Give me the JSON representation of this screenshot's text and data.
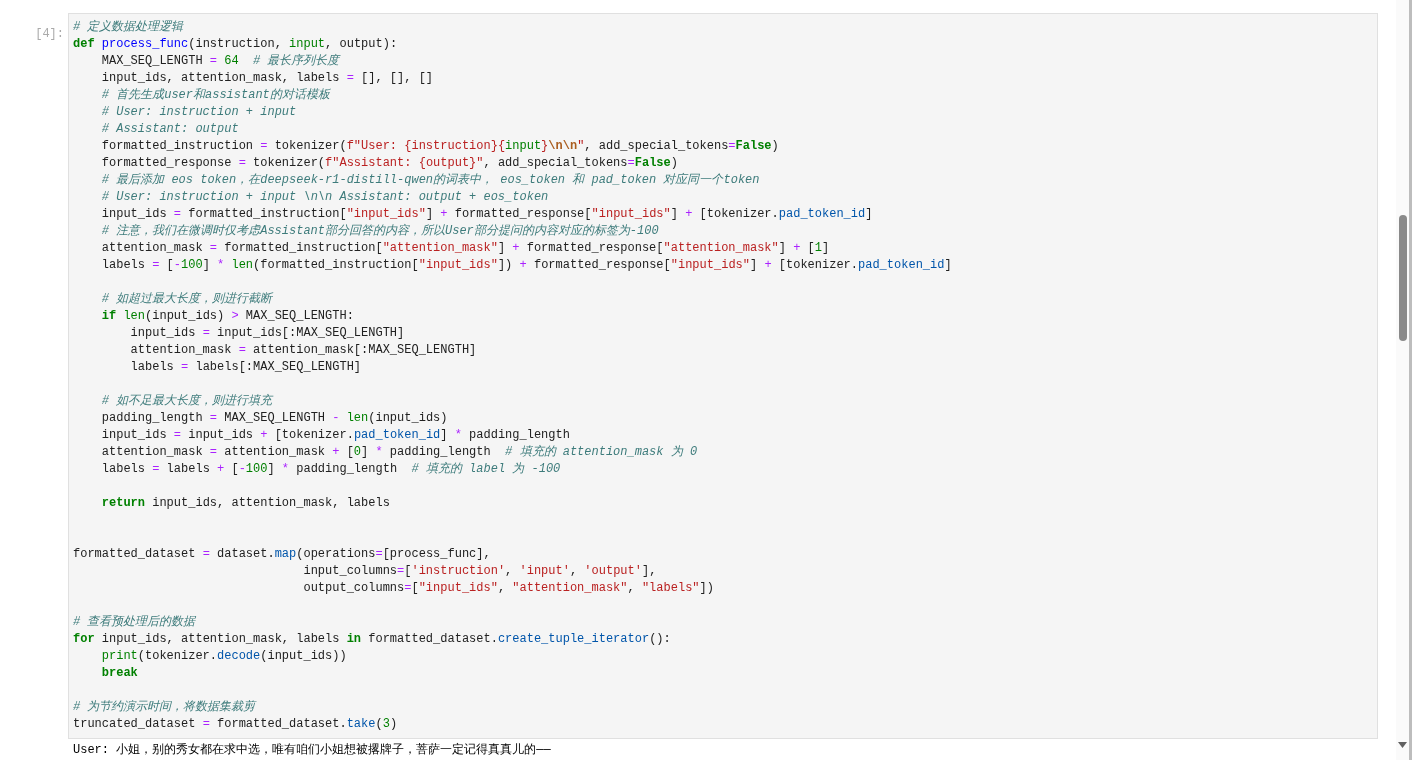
{
  "cell": {
    "prompt": "[4]:",
    "lines": [
      {
        "tokens": [
          {
            "kind": "comment",
            "text": "# 定义数据处理逻辑"
          }
        ]
      },
      {
        "tokens": [
          {
            "kind": "keyword",
            "text": "def "
          },
          {
            "kind": "function",
            "text": "process_func"
          },
          {
            "kind": "plain",
            "text": "(instruction, "
          },
          {
            "kind": "builtin",
            "text": "input"
          },
          {
            "kind": "plain",
            "text": ", output):"
          }
        ]
      },
      {
        "tokens": [
          {
            "kind": "plain",
            "text": "    MAX_SEQ_LENGTH "
          },
          {
            "kind": "operator",
            "text": "= "
          },
          {
            "kind": "number",
            "text": "64"
          },
          {
            "kind": "comment",
            "text": "  # 最长序列长度"
          }
        ]
      },
      {
        "tokens": [
          {
            "kind": "plain",
            "text": "    input_ids, attention_mask, labels "
          },
          {
            "kind": "operator",
            "text": "="
          },
          {
            "kind": "plain",
            "text": " [], [], []"
          }
        ]
      },
      {
        "tokens": [
          {
            "kind": "comment",
            "text": "    # 首先生成user和assistant的对话模板"
          }
        ]
      },
      {
        "tokens": [
          {
            "kind": "comment",
            "text": "    # User: instruction + input"
          }
        ]
      },
      {
        "tokens": [
          {
            "kind": "comment",
            "text": "    # Assistant: output"
          }
        ]
      },
      {
        "tokens": [
          {
            "kind": "plain",
            "text": "    formatted_instruction "
          },
          {
            "kind": "operator",
            "text": "="
          },
          {
            "kind": "plain",
            "text": " tokenizer("
          },
          {
            "kind": "string",
            "text": "f\"User: {instruction}{"
          },
          {
            "kind": "builtin",
            "text": "input"
          },
          {
            "kind": "string",
            "text": "}"
          },
          {
            "kind": "escape",
            "text": "\\n\\n"
          },
          {
            "kind": "string",
            "text": "\""
          },
          {
            "kind": "plain",
            "text": ", add_special_tokens"
          },
          {
            "kind": "operator",
            "text": "="
          },
          {
            "kind": "keyword",
            "text": "False"
          },
          {
            "kind": "plain",
            "text": ")"
          }
        ]
      },
      {
        "tokens": [
          {
            "kind": "plain",
            "text": "    formatted_response "
          },
          {
            "kind": "operator",
            "text": "="
          },
          {
            "kind": "plain",
            "text": " tokenizer("
          },
          {
            "kind": "string",
            "text": "f\"Assistant: {output}\""
          },
          {
            "kind": "plain",
            "text": ", add_special_tokens"
          },
          {
            "kind": "operator",
            "text": "="
          },
          {
            "kind": "keyword",
            "text": "False"
          },
          {
            "kind": "plain",
            "text": ")"
          }
        ]
      },
      {
        "tokens": [
          {
            "kind": "comment",
            "text": "    # 最后添加 eos token，在deepseek-r1-distill-qwen的词表中， eos_token 和 pad_token 对应同一个token"
          }
        ]
      },
      {
        "tokens": [
          {
            "kind": "comment",
            "text": "    # User: instruction + input \\n\\n Assistant: output + eos_token"
          }
        ]
      },
      {
        "tokens": [
          {
            "kind": "plain",
            "text": "    input_ids "
          },
          {
            "kind": "operator",
            "text": "="
          },
          {
            "kind": "plain",
            "text": " formatted_instruction["
          },
          {
            "kind": "string",
            "text": "\"input_ids\""
          },
          {
            "kind": "plain",
            "text": "] "
          },
          {
            "kind": "operator",
            "text": "+"
          },
          {
            "kind": "plain",
            "text": " formatted_response["
          },
          {
            "kind": "string",
            "text": "\"input_ids\""
          },
          {
            "kind": "plain",
            "text": "] "
          },
          {
            "kind": "operator",
            "text": "+"
          },
          {
            "kind": "plain",
            "text": " [tokenizer."
          },
          {
            "kind": "attribute",
            "text": "pad_token_id"
          },
          {
            "kind": "plain",
            "text": "]"
          }
        ]
      },
      {
        "tokens": [
          {
            "kind": "comment",
            "text": "    # 注意，我们在微调时仅考虑Assistant部分回答的内容，所以User部分提问的内容对应的标签为-100"
          }
        ]
      },
      {
        "tokens": [
          {
            "kind": "plain",
            "text": "    attention_mask "
          },
          {
            "kind": "operator",
            "text": "="
          },
          {
            "kind": "plain",
            "text": " formatted_instruction["
          },
          {
            "kind": "string",
            "text": "\"attention_mask\""
          },
          {
            "kind": "plain",
            "text": "] "
          },
          {
            "kind": "operator",
            "text": "+"
          },
          {
            "kind": "plain",
            "text": " formatted_response["
          },
          {
            "kind": "string",
            "text": "\"attention_mask\""
          },
          {
            "kind": "plain",
            "text": "] "
          },
          {
            "kind": "operator",
            "text": "+"
          },
          {
            "kind": "plain",
            "text": " ["
          },
          {
            "kind": "number",
            "text": "1"
          },
          {
            "kind": "plain",
            "text": "]"
          }
        ]
      },
      {
        "tokens": [
          {
            "kind": "plain",
            "text": "    labels "
          },
          {
            "kind": "operator",
            "text": "="
          },
          {
            "kind": "plain",
            "text": " ["
          },
          {
            "kind": "operator",
            "text": "-"
          },
          {
            "kind": "number",
            "text": "100"
          },
          {
            "kind": "plain",
            "text": "] "
          },
          {
            "kind": "operator",
            "text": "* "
          },
          {
            "kind": "builtin",
            "text": "len"
          },
          {
            "kind": "plain",
            "text": "(formatted_instruction["
          },
          {
            "kind": "string",
            "text": "\"input_ids\""
          },
          {
            "kind": "plain",
            "text": "]) "
          },
          {
            "kind": "operator",
            "text": "+"
          },
          {
            "kind": "plain",
            "text": " formatted_response["
          },
          {
            "kind": "string",
            "text": "\"input_ids\""
          },
          {
            "kind": "plain",
            "text": "] "
          },
          {
            "kind": "operator",
            "text": "+"
          },
          {
            "kind": "plain",
            "text": " [tokenizer."
          },
          {
            "kind": "attribute",
            "text": "pad_token_id"
          },
          {
            "kind": "plain",
            "text": "]"
          }
        ]
      },
      {
        "kind": "blank"
      },
      {
        "tokens": [
          {
            "kind": "comment",
            "text": "    # 如超过最大长度，则进行截断"
          }
        ]
      },
      {
        "tokens": [
          {
            "kind": "keyword",
            "text": "    if "
          },
          {
            "kind": "builtin",
            "text": "len"
          },
          {
            "kind": "plain",
            "text": "(input_ids) "
          },
          {
            "kind": "operator",
            "text": ">"
          },
          {
            "kind": "plain",
            "text": " MAX_SEQ_LENGTH:"
          }
        ]
      },
      {
        "tokens": [
          {
            "kind": "plain",
            "text": "        input_ids "
          },
          {
            "kind": "operator",
            "text": "="
          },
          {
            "kind": "plain",
            "text": " input_ids[:MAX_SEQ_LENGTH]"
          }
        ]
      },
      {
        "tokens": [
          {
            "kind": "plain",
            "text": "        attention_mask "
          },
          {
            "kind": "operator",
            "text": "="
          },
          {
            "kind": "plain",
            "text": " attention_mask[:MAX_SEQ_LENGTH]"
          }
        ]
      },
      {
        "tokens": [
          {
            "kind": "plain",
            "text": "        labels "
          },
          {
            "kind": "operator",
            "text": "="
          },
          {
            "kind": "plain",
            "text": " labels[:MAX_SEQ_LENGTH]"
          }
        ]
      },
      {
        "kind": "blank"
      },
      {
        "tokens": [
          {
            "kind": "comment",
            "text": "    # 如不足最大长度，则进行填充"
          }
        ]
      },
      {
        "tokens": [
          {
            "kind": "plain",
            "text": "    padding_length "
          },
          {
            "kind": "operator",
            "text": "="
          },
          {
            "kind": "plain",
            "text": " MAX_SEQ_LENGTH "
          },
          {
            "kind": "operator",
            "text": "- "
          },
          {
            "kind": "builtin",
            "text": "len"
          },
          {
            "kind": "plain",
            "text": "(input_ids)"
          }
        ]
      },
      {
        "tokens": [
          {
            "kind": "plain",
            "text": "    input_ids "
          },
          {
            "kind": "operator",
            "text": "="
          },
          {
            "kind": "plain",
            "text": " input_ids "
          },
          {
            "kind": "operator",
            "text": "+"
          },
          {
            "kind": "plain",
            "text": " [tokenizer."
          },
          {
            "kind": "attribute",
            "text": "pad_token_id"
          },
          {
            "kind": "plain",
            "text": "] "
          },
          {
            "kind": "operator",
            "text": "*"
          },
          {
            "kind": "plain",
            "text": " padding_length"
          }
        ]
      },
      {
        "tokens": [
          {
            "kind": "plain",
            "text": "    attention_mask "
          },
          {
            "kind": "operator",
            "text": "="
          },
          {
            "kind": "plain",
            "text": " attention_mask "
          },
          {
            "kind": "operator",
            "text": "+"
          },
          {
            "kind": "plain",
            "text": " ["
          },
          {
            "kind": "number",
            "text": "0"
          },
          {
            "kind": "plain",
            "text": "] "
          },
          {
            "kind": "operator",
            "text": "*"
          },
          {
            "kind": "plain",
            "text": " padding_length"
          },
          {
            "kind": "comment",
            "text": "  # 填充的 attention_mask 为 0"
          }
        ]
      },
      {
        "tokens": [
          {
            "kind": "plain",
            "text": "    labels "
          },
          {
            "kind": "operator",
            "text": "="
          },
          {
            "kind": "plain",
            "text": " labels "
          },
          {
            "kind": "operator",
            "text": "+"
          },
          {
            "kind": "plain",
            "text": " ["
          },
          {
            "kind": "operator",
            "text": "-"
          },
          {
            "kind": "number",
            "text": "100"
          },
          {
            "kind": "plain",
            "text": "] "
          },
          {
            "kind": "operator",
            "text": "*"
          },
          {
            "kind": "plain",
            "text": " padding_length"
          },
          {
            "kind": "comment",
            "text": "  # 填充的 label 为 -100"
          }
        ]
      },
      {
        "kind": "blank"
      },
      {
        "tokens": [
          {
            "kind": "keyword",
            "text": "    return"
          },
          {
            "kind": "plain",
            "text": " input_ids, attention_mask, labels"
          }
        ]
      },
      {
        "kind": "blank"
      },
      {
        "kind": "blank"
      },
      {
        "tokens": [
          {
            "kind": "plain",
            "text": "formatted_dataset "
          },
          {
            "kind": "operator",
            "text": "="
          },
          {
            "kind": "plain",
            "text": " dataset."
          },
          {
            "kind": "attribute",
            "text": "map"
          },
          {
            "kind": "plain",
            "text": "(operations"
          },
          {
            "kind": "operator",
            "text": "="
          },
          {
            "kind": "plain",
            "text": "[process_func],"
          }
        ]
      },
      {
        "tokens": [
          {
            "kind": "plain",
            "text": "                                input_columns"
          },
          {
            "kind": "operator",
            "text": "="
          },
          {
            "kind": "plain",
            "text": "["
          },
          {
            "kind": "string",
            "text": "'instruction'"
          },
          {
            "kind": "plain",
            "text": ", "
          },
          {
            "kind": "string",
            "text": "'input'"
          },
          {
            "kind": "plain",
            "text": ", "
          },
          {
            "kind": "string",
            "text": "'output'"
          },
          {
            "kind": "plain",
            "text": "],"
          }
        ]
      },
      {
        "tokens": [
          {
            "kind": "plain",
            "text": "                                output_columns"
          },
          {
            "kind": "operator",
            "text": "="
          },
          {
            "kind": "plain",
            "text": "["
          },
          {
            "kind": "string",
            "text": "\"input_ids\""
          },
          {
            "kind": "plain",
            "text": ", "
          },
          {
            "kind": "string",
            "text": "\"attention_mask\""
          },
          {
            "kind": "plain",
            "text": ", "
          },
          {
            "kind": "string",
            "text": "\"labels\""
          },
          {
            "kind": "plain",
            "text": "])"
          }
        ]
      },
      {
        "kind": "blank"
      },
      {
        "tokens": [
          {
            "kind": "comment",
            "text": "# 查看预处理后的数据"
          }
        ]
      },
      {
        "tokens": [
          {
            "kind": "keyword",
            "text": "for"
          },
          {
            "kind": "plain",
            "text": " input_ids, attention_mask, labels "
          },
          {
            "kind": "keyword",
            "text": "in"
          },
          {
            "kind": "plain",
            "text": " formatted_dataset."
          },
          {
            "kind": "attribute",
            "text": "create_tuple_iterator"
          },
          {
            "kind": "plain",
            "text": "():"
          }
        ]
      },
      {
        "tokens": [
          {
            "kind": "builtin",
            "text": "    print"
          },
          {
            "kind": "plain",
            "text": "(tokenizer."
          },
          {
            "kind": "attribute",
            "text": "decode"
          },
          {
            "kind": "plain",
            "text": "(input_ids))"
          }
        ]
      },
      {
        "tokens": [
          {
            "kind": "keyword",
            "text": "    break"
          }
        ]
      },
      {
        "kind": "blank"
      },
      {
        "tokens": [
          {
            "kind": "comment",
            "text": "# 为节约演示时间，将数据集裁剪"
          }
        ]
      },
      {
        "tokens": [
          {
            "kind": "plain",
            "text": "truncated_dataset "
          },
          {
            "kind": "operator",
            "text": "="
          },
          {
            "kind": "plain",
            "text": " formatted_dataset."
          },
          {
            "kind": "attribute",
            "text": "take"
          },
          {
            "kind": "plain",
            "text": "("
          },
          {
            "kind": "number",
            "text": "3"
          },
          {
            "kind": "plain",
            "text": ")"
          }
        ]
      }
    ]
  },
  "output": {
    "text": "User: 小姐，别的秀女都在求中选，唯有咱们小姐想被撂牌子，菩萨一定记得真真儿的——"
  }
}
